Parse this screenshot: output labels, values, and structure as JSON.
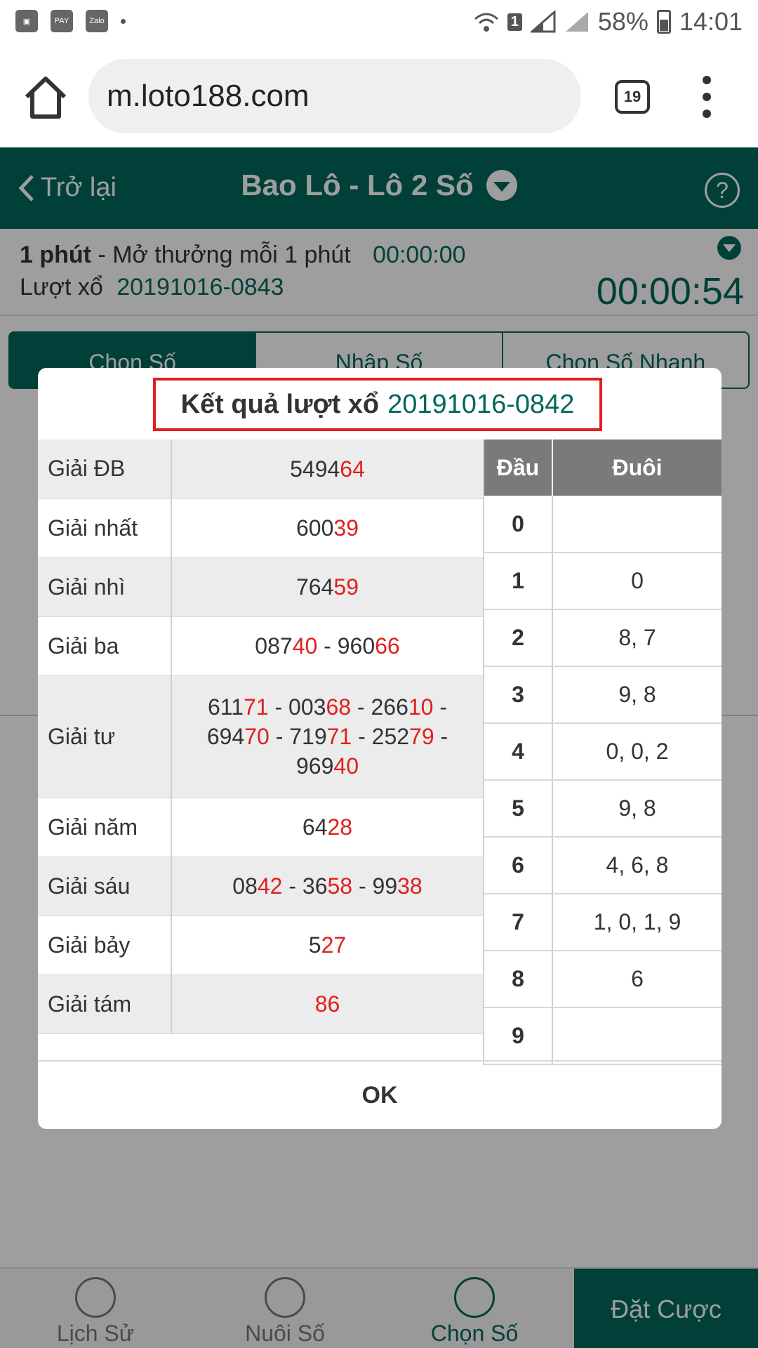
{
  "status_bar": {
    "battery": "58%",
    "time": "14:01",
    "sim": "1"
  },
  "browser": {
    "url": "m.loto188.com",
    "tab_count": "19"
  },
  "header": {
    "back_label": "Trở lại",
    "title": "Bao Lô - Lô 2 Số"
  },
  "draw_info": {
    "game": "1 phút",
    "description": "- Mở thưởng mỗi 1 phút",
    "timer": "00:00:00",
    "round_label": "Lượt xổ",
    "round_code": "20191016-0843",
    "countdown": "00:00:54"
  },
  "tabs": [
    {
      "label": "Chọn Số",
      "active": true
    },
    {
      "label": "Nhập Số",
      "active": false
    },
    {
      "label": "Chọn Số Nhanh",
      "active": false
    }
  ],
  "modal": {
    "title_prefix": "Kết quả lượt xổ",
    "title_code": "20191016-0842",
    "prizes": [
      {
        "name": "Giải ĐB",
        "numbers": [
          [
            "5494",
            "64"
          ]
        ]
      },
      {
        "name": "Giải nhất",
        "numbers": [
          [
            "600",
            "39"
          ]
        ]
      },
      {
        "name": "Giải nhì",
        "numbers": [
          [
            "764",
            "59"
          ]
        ]
      },
      {
        "name": "Giải ba",
        "numbers": [
          [
            "087",
            "40"
          ],
          [
            "960",
            "66"
          ]
        ]
      },
      {
        "name": "Giải tư",
        "numbers": [
          [
            "611",
            "71"
          ],
          [
            "003",
            "68"
          ],
          [
            "266",
            "10"
          ],
          [
            "694",
            "70"
          ],
          [
            "719",
            "71"
          ],
          [
            "252",
            "79"
          ],
          [
            "969",
            "40"
          ]
        ]
      },
      {
        "name": "Giải năm",
        "numbers": [
          [
            "64",
            "28"
          ]
        ]
      },
      {
        "name": "Giải sáu",
        "numbers": [
          [
            "08",
            "42"
          ],
          [
            "36",
            "58"
          ],
          [
            "99",
            "38"
          ]
        ]
      },
      {
        "name": "Giải bảy",
        "numbers": [
          [
            "5",
            "27"
          ]
        ]
      },
      {
        "name": "Giải tám",
        "numbers": [
          [
            "",
            "86"
          ]
        ]
      }
    ],
    "dau_duoi_headers": {
      "dau": "Đầu",
      "duoi": "Đuôi"
    },
    "dau_duoi": [
      {
        "dau": "0",
        "duoi": ""
      },
      {
        "dau": "1",
        "duoi": "0"
      },
      {
        "dau": "2",
        "duoi": "8, 7"
      },
      {
        "dau": "3",
        "duoi": "9, 8"
      },
      {
        "dau": "4",
        "duoi": "0, 0, 2"
      },
      {
        "dau": "5",
        "duoi": "9, 8"
      },
      {
        "dau": "6",
        "duoi": "4, 6, 8"
      },
      {
        "dau": "7",
        "duoi": "1, 0, 1, 9"
      },
      {
        "dau": "8",
        "duoi": "6"
      },
      {
        "dau": "9",
        "duoi": ""
      }
    ],
    "ok_label": "OK"
  },
  "bottom_nav": [
    {
      "label": "Lịch Sử",
      "icon": "clock-icon"
    },
    {
      "label": "Nuôi Số",
      "icon": "plus-circle-icon"
    },
    {
      "label": "Chọn Số",
      "icon": "check-circle-icon"
    }
  ],
  "bet_button": "Đặt Cược",
  "colors": {
    "primary": "#00675a",
    "highlight": "#e0201e"
  }
}
